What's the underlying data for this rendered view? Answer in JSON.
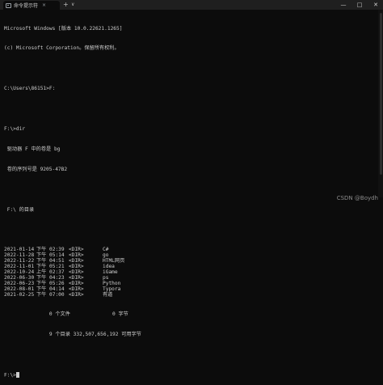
{
  "window": {
    "tab_title": "命令提示符",
    "tab_close": "×",
    "new_tab": "+",
    "tab_dropdown": "∨",
    "minimize": "—",
    "maximize": "□",
    "close": "✕"
  },
  "terminal": {
    "header1": "Microsoft Windows [版本 10.0.22621.1265]",
    "header2": "(c) Microsoft Corporation。保留所有权利。",
    "cmd1": "C:\\Users\\86151>F:",
    "cmd2": "F:\\>dir",
    "vol1": " 驱动器 F 中的卷是 bg",
    "vol2": " 卷的序列号是 9205-47B2",
    "dir_of": " F:\\ 的目录",
    "entries": [
      {
        "date": "2021-01-14",
        "ampm": "下午",
        "time": "02:39",
        "type": "<DIR>",
        "size": "",
        "name": "C#"
      },
      {
        "date": "2022-11-28",
        "ampm": "下午",
        "time": "05:14",
        "type": "<DIR>",
        "size": "",
        "name": "go"
      },
      {
        "date": "2022-11-22",
        "ampm": "下午",
        "time": "04:51",
        "type": "<DIR>",
        "size": "",
        "name": "HTML网页"
      },
      {
        "date": "2022-11-01",
        "ampm": "下午",
        "time": "05:21",
        "type": "<DIR>",
        "size": "",
        "name": "idea"
      },
      {
        "date": "2022-10-24",
        "ampm": "上午",
        "time": "02:37",
        "type": "<DIR>",
        "size": "",
        "name": "iGame"
      },
      {
        "date": "2022-06-30",
        "ampm": "下午",
        "time": "04:23",
        "type": "<DIR>",
        "size": "",
        "name": "ps"
      },
      {
        "date": "2022-06-23",
        "ampm": "下午",
        "time": "05:26",
        "type": "<DIR>",
        "size": "",
        "name": "Python"
      },
      {
        "date": "2022-08-01",
        "ampm": "下午",
        "time": "04:14",
        "type": "<DIR>",
        "size": "",
        "name": "Typora"
      },
      {
        "date": "2021-02-25",
        "ampm": "下午",
        "time": "07:00",
        "type": "<DIR>",
        "size": "",
        "name": "有道"
      }
    ],
    "summary1": "               0 个文件              0 字节",
    "summary2": "               9 个目录 332,507,656,192 可用字节",
    "prompt": "F:\\>"
  },
  "watermark": "CSDN @Boydh"
}
